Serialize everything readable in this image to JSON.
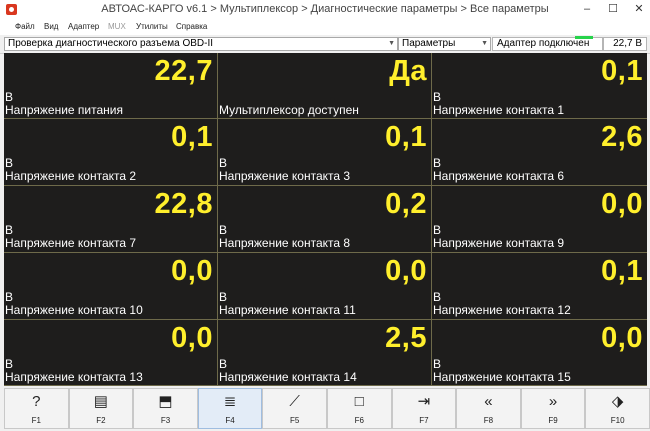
{
  "window": {
    "title": "АВТОАС-КАРГО v6.1 > Мультиплексор > Диагностические параметры > Все параметры",
    "minimize": "–",
    "maximize": "☐",
    "close": "✕"
  },
  "menu": {
    "file": "Файл",
    "view": "Вид",
    "adapter": "Адаптер",
    "mux": "MUX",
    "utilities": "Утилиты",
    "help": "Справка"
  },
  "toolbar": {
    "test_select": "Проверка диагностического разъема OBD-II",
    "mode_select": "Параметры",
    "adapter_status": "Адаптер подключен",
    "adapter_voltage": "22,7 В",
    "status_color": "#27d34b"
  },
  "params": [
    {
      "value": "22,7",
      "unit": "В",
      "label": "Напряжение питания"
    },
    {
      "value": "Да",
      "unit": "",
      "label": "Мультиплексор доступен"
    },
    {
      "value": "0,1",
      "unit": "В",
      "label": "Напряжение контакта 1"
    },
    {
      "value": "0,1",
      "unit": "В",
      "label": "Напряжение контакта 2"
    },
    {
      "value": "0,1",
      "unit": "В",
      "label": "Напряжение контакта 3"
    },
    {
      "value": "2,6",
      "unit": "В",
      "label": "Напряжение контакта 6"
    },
    {
      "value": "22,8",
      "unit": "В",
      "label": "Напряжение контакта 7"
    },
    {
      "value": "0,2",
      "unit": "В",
      "label": "Напряжение контакта 8"
    },
    {
      "value": "0,0",
      "unit": "В",
      "label": "Напряжение контакта 9"
    },
    {
      "value": "0,0",
      "unit": "В",
      "label": "Напряжение контакта 10"
    },
    {
      "value": "0,0",
      "unit": "В",
      "label": "Напряжение контакта 11"
    },
    {
      "value": "0,1",
      "unit": "В",
      "label": "Напряжение контакта 12"
    },
    {
      "value": "0,0",
      "unit": "В",
      "label": "Напряжение контакта 13"
    },
    {
      "value": "2,5",
      "unit": "В",
      "label": "Напряжение контакта 14"
    },
    {
      "value": "0,0",
      "unit": "В",
      "label": "Напряжение контакта 15"
    }
  ],
  "fkeys": [
    {
      "key": "F1",
      "icon": "help-icon"
    },
    {
      "key": "F2",
      "icon": "print-icon"
    },
    {
      "key": "F3",
      "icon": "export-icon"
    },
    {
      "key": "F4",
      "icon": "list-icon"
    },
    {
      "key": "F5",
      "icon": "broom-icon"
    },
    {
      "key": "F6",
      "icon": "stop-icon"
    },
    {
      "key": "F7",
      "icon": "record-icon"
    },
    {
      "key": "F8",
      "icon": "rewind-icon"
    },
    {
      "key": "F9",
      "icon": "fast-forward-icon"
    },
    {
      "key": "F10",
      "icon": "exit-icon"
    }
  ],
  "colors": {
    "value": "#ffef2c",
    "panel_bg": "#1e1d1c",
    "cell_border": "#6e6a4a"
  }
}
